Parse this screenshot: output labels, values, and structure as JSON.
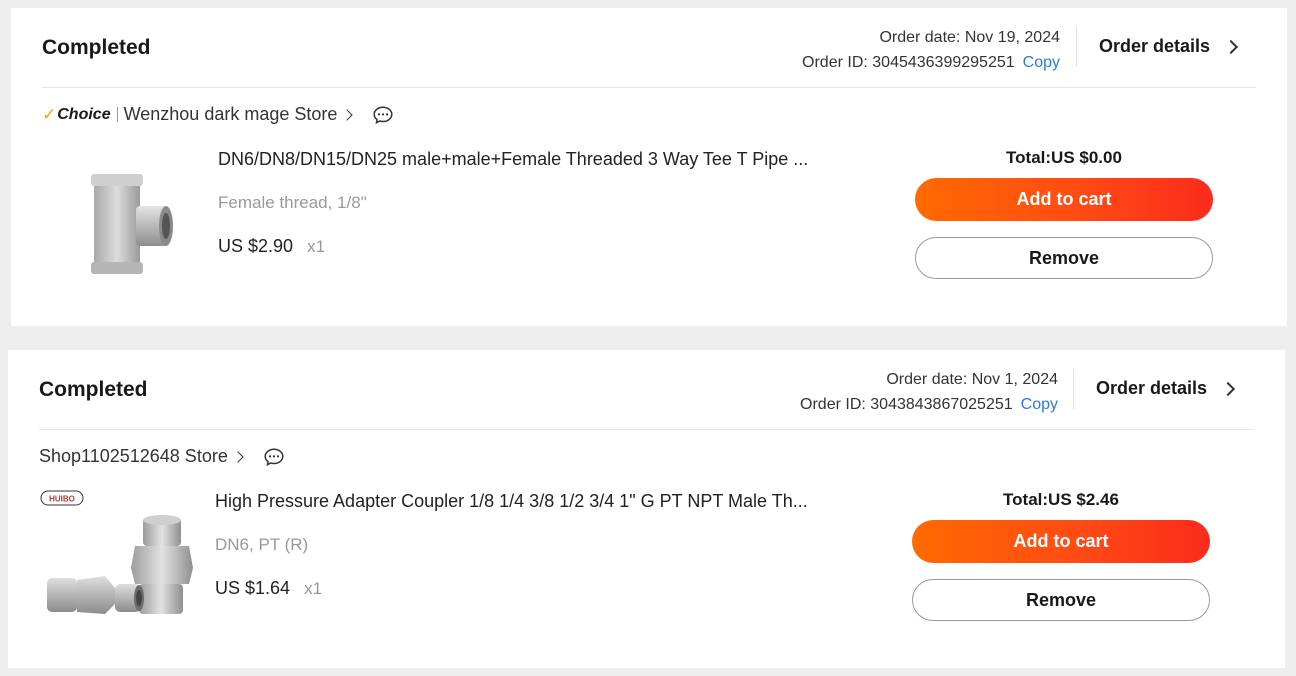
{
  "orders": [
    {
      "status": "Completed",
      "order_date": "Order date: Nov 19, 2024",
      "order_id": "Order ID: 3045436399295251",
      "copy_label": "Copy",
      "details_label": "Order details",
      "choice_label": "Choice",
      "store_name": "Wenzhou dark mage Store",
      "item": {
        "title": "DN6/DN8/DN15/DN25 male+male+Female Threaded 3 Way Tee T Pipe ...",
        "sku": "Female thread, 1/8\"",
        "price": "US $2.90",
        "qty": "x1",
        "image_icon": "tee-pipe-fitting"
      },
      "total": "Total:US $0.00",
      "add_to_cart_label": "Add to cart",
      "remove_label": "Remove"
    },
    {
      "status": "Completed",
      "order_date": "Order date: Nov 1, 2024",
      "order_id": "Order ID: 3043843867025251",
      "copy_label": "Copy",
      "details_label": "Order details",
      "store_name": "Shop1102512648 Store",
      "item": {
        "title": "High Pressure Adapter Coupler 1/8 1/4 3/8 1/2 3/4 1\" G PT NPT Male Th...",
        "sku": "DN6, PT (R)",
        "price": "US $1.64",
        "qty": "x1",
        "brand_logo": "HUIBO",
        "image_icon": "hex-nipple-adapter"
      },
      "total": "Total:US $2.46",
      "add_to_cart_label": "Add to cart",
      "remove_label": "Remove"
    }
  ],
  "colors": {
    "accent_orange": "#ff6a00",
    "accent_red": "#fb2b1c",
    "link_blue": "#2e7ae0",
    "choice_tick": "#f7a800"
  }
}
